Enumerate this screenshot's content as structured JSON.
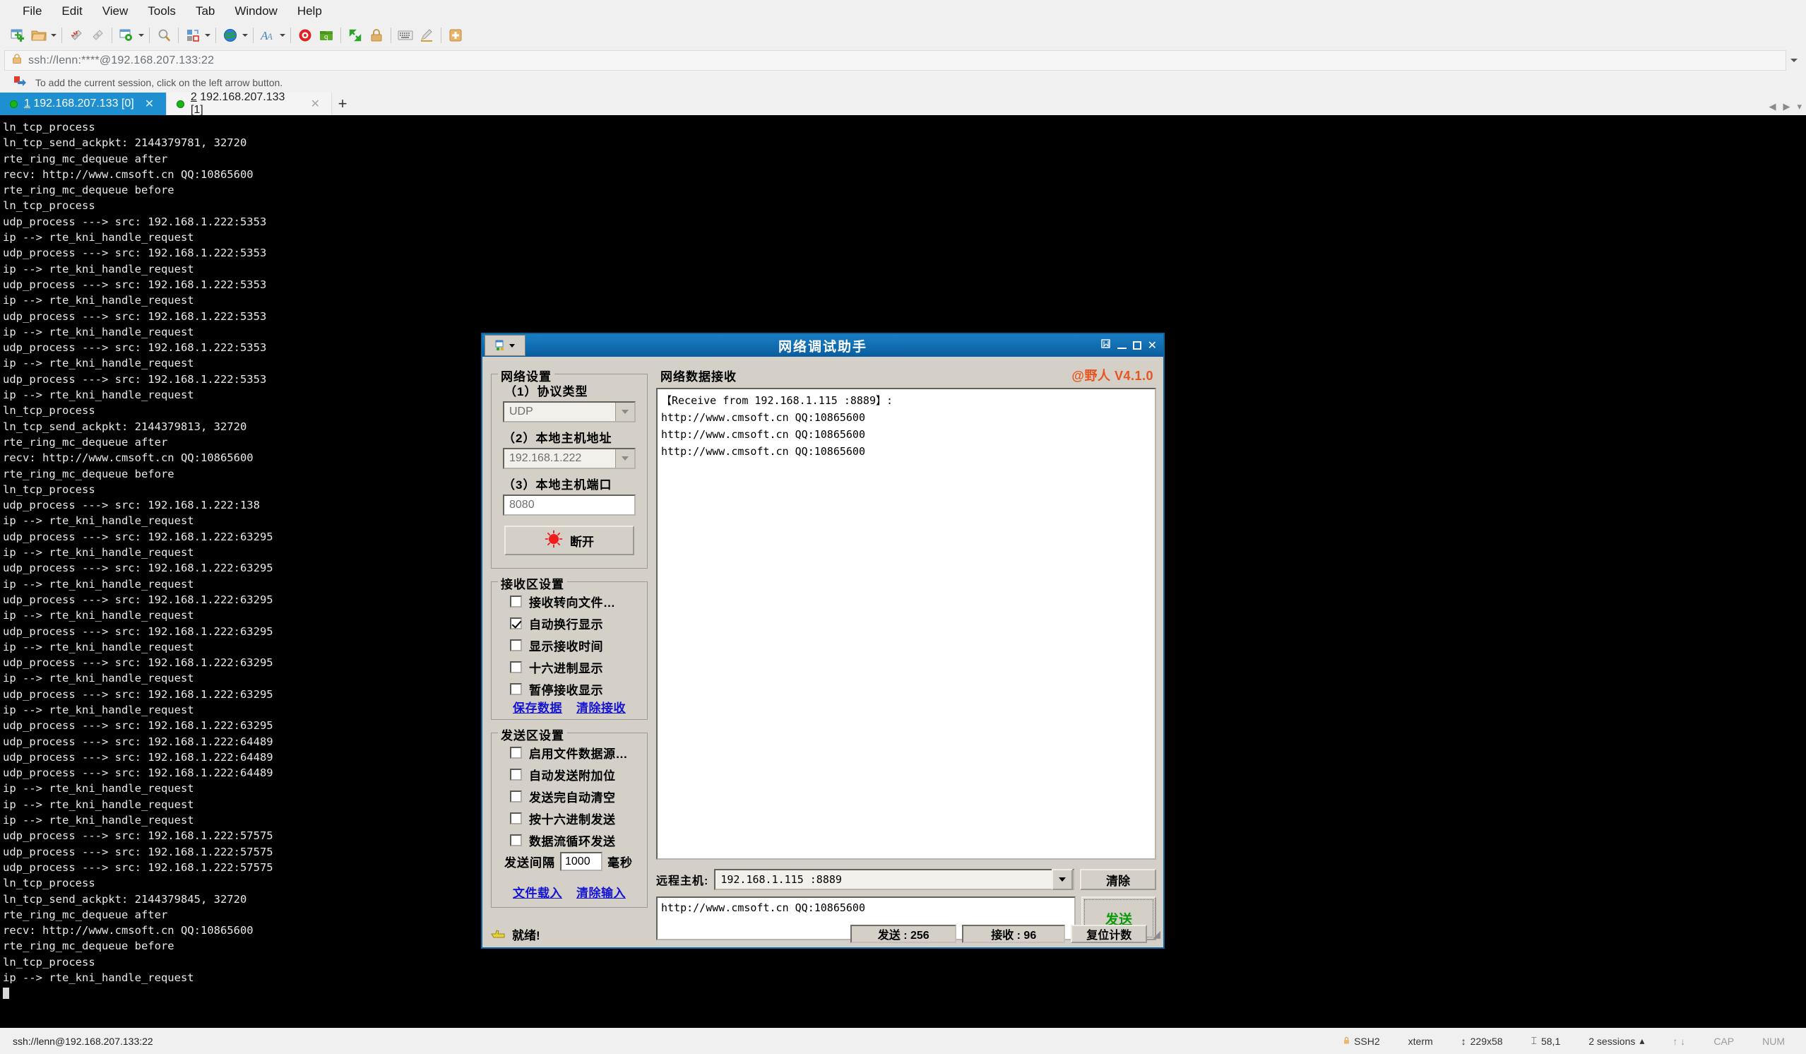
{
  "menubar": [
    "File",
    "Edit",
    "View",
    "Tools",
    "Tab",
    "Window",
    "Help"
  ],
  "address": {
    "value": "ssh://lenn:****@192.168.207.133:22",
    "lock_icon": "lock-icon"
  },
  "hint": {
    "text": "To add the current session, click on the left arrow button.",
    "icon": "red-blue-arrow-icon"
  },
  "tabs": [
    {
      "num": "1",
      "label": "192.168.207.133 [0]",
      "active": true
    },
    {
      "num": "2",
      "label": "192.168.207.133 [1]",
      "active": false
    }
  ],
  "tab_add_label": "+",
  "terminal": {
    "lines": [
      "ln_tcp_process",
      "ln_tcp_send_ackpkt: 2144379781, 32720",
      "rte_ring_mc_dequeue after",
      "recv: http://www.cmsoft.cn QQ:10865600",
      "rte_ring_mc_dequeue before",
      "ln_tcp_process",
      "udp_process ---> src: 192.168.1.222:5353",
      "ip --> rte_kni_handle_request",
      "udp_process ---> src: 192.168.1.222:5353",
      "ip --> rte_kni_handle_request",
      "udp_process ---> src: 192.168.1.222:5353",
      "ip --> rte_kni_handle_request",
      "udp_process ---> src: 192.168.1.222:5353",
      "ip --> rte_kni_handle_request",
      "udp_process ---> src: 192.168.1.222:5353",
      "ip --> rte_kni_handle_request",
      "udp_process ---> src: 192.168.1.222:5353",
      "ip --> rte_kni_handle_request",
      "ln_tcp_process",
      "ln_tcp_send_ackpkt: 2144379813, 32720",
      "rte_ring_mc_dequeue after",
      "recv: http://www.cmsoft.cn QQ:10865600",
      "rte_ring_mc_dequeue before",
      "ln_tcp_process",
      "udp_process ---> src: 192.168.1.222:138",
      "ip --> rte_kni_handle_request",
      "udp_process ---> src: 192.168.1.222:63295",
      "ip --> rte_kni_handle_request",
      "udp_process ---> src: 192.168.1.222:63295",
      "ip --> rte_kni_handle_request",
      "udp_process ---> src: 192.168.1.222:63295",
      "ip --> rte_kni_handle_request",
      "udp_process ---> src: 192.168.1.222:63295",
      "ip --> rte_kni_handle_request",
      "udp_process ---> src: 192.168.1.222:63295",
      "ip --> rte_kni_handle_request",
      "udp_process ---> src: 192.168.1.222:63295",
      "ip --> rte_kni_handle_request",
      "udp_process ---> src: 192.168.1.222:63295",
      "udp_process ---> src: 192.168.1.222:64489",
      "udp_process ---> src: 192.168.1.222:64489",
      "udp_process ---> src: 192.168.1.222:64489",
      "ip --> rte_kni_handle_request",
      "ip --> rte_kni_handle_request",
      "ip --> rte_kni_handle_request",
      "udp_process ---> src: 192.168.1.222:57575",
      "udp_process ---> src: 192.168.1.222:57575",
      "udp_process ---> src: 192.168.1.222:57575",
      "ln_tcp_process",
      "ln_tcp_send_ackpkt: 2144379845, 32720",
      "rte_ring_mc_dequeue after",
      "recv: http://www.cmsoft.cn QQ:10865600",
      "rte_ring_mc_dequeue before",
      "ln_tcp_process",
      "ip --> rte_kni_handle_request"
    ]
  },
  "statusbar": {
    "connection": "ssh://lenn@192.168.207.133:22",
    "protocol": "SSH2",
    "termtype": "xterm",
    "size": "229x58",
    "cursor": "58,1",
    "sessions": "2 sessions",
    "cap": "CAP",
    "num": "NUM"
  },
  "dialog": {
    "title": "网络调试助手",
    "brand": "@野人 V4.1.0",
    "titlebar": {
      "pin": "pin-icon",
      "minimize": "minimize-icon",
      "maximize": "maximize-icon",
      "close": "close-icon"
    },
    "network_settings": {
      "caption": "网络设置",
      "protocol_label": "（1）协议类型",
      "protocol_value": "UDP",
      "host_label": "（2）本地主机地址",
      "host_value": "192.168.1.222",
      "port_label": "（3）本地主机端口",
      "port_value": "8080",
      "connect_button": "断开"
    },
    "recv_settings": {
      "caption": "接收区设置",
      "checkboxes": [
        {
          "label": "接收转向文件…",
          "checked": false
        },
        {
          "label": "自动换行显示",
          "checked": true
        },
        {
          "label": "显示接收时间",
          "checked": false
        },
        {
          "label": "十六进制显示",
          "checked": false
        },
        {
          "label": "暂停接收显示",
          "checked": false
        }
      ],
      "links": [
        "保存数据",
        "清除接收"
      ]
    },
    "send_settings": {
      "caption": "发送区设置",
      "checkboxes": [
        {
          "label": "启用文件数据源…",
          "checked": false
        },
        {
          "label": "自动发送附加位",
          "checked": false
        },
        {
          "label": "发送完自动清空",
          "checked": false
        },
        {
          "label": "按十六进制发送",
          "checked": false
        },
        {
          "label": "数据流循环发送",
          "checked": false
        }
      ],
      "interval_label": "发送间隔",
      "interval_value": "1000",
      "interval_unit": "毫秒",
      "links": [
        "文件载入",
        "清除输入"
      ]
    },
    "recv_area": {
      "caption": "网络数据接收",
      "lines": [
        "【Receive from 192.168.1.115 :8889】:",
        "http://www.cmsoft.cn QQ:10865600",
        "http://www.cmsoft.cn QQ:10865600",
        "http://www.cmsoft.cn QQ:10865600"
      ]
    },
    "remote": {
      "label": "远程主机:",
      "value": "192.168.1.115  :8889",
      "clear_button": "清除"
    },
    "send_box": {
      "value": "http://www.cmsoft.cn QQ:10865600",
      "send_button": "发送"
    },
    "status": {
      "ready": "就绪!",
      "sent": "发送 : 256",
      "received": "接收 : 96",
      "reset_button": "复位计数"
    }
  }
}
